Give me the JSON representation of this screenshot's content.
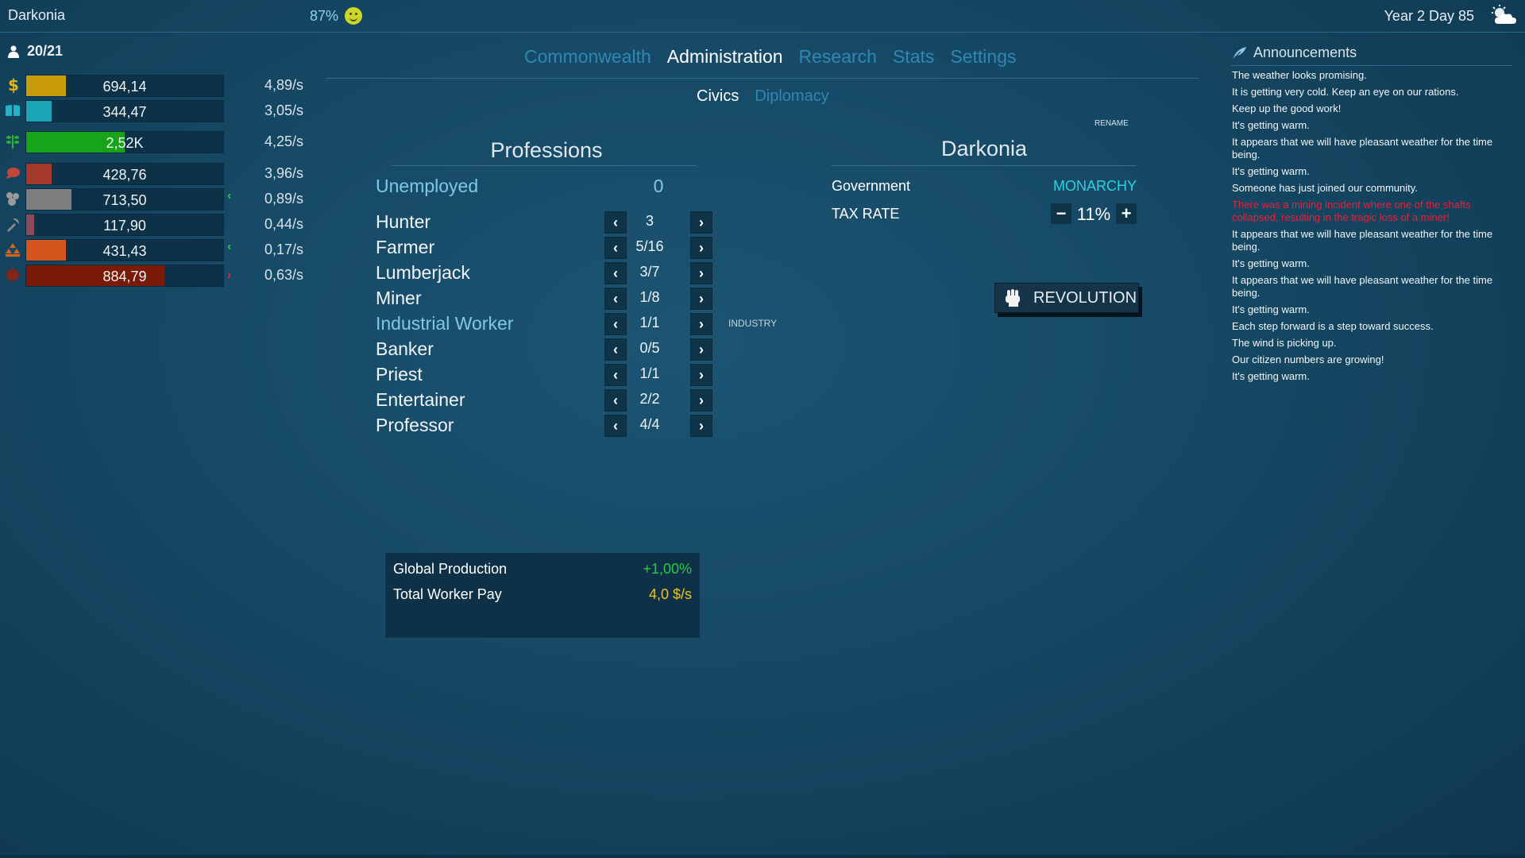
{
  "header": {
    "country_name": "Darkonia",
    "happiness": "87%",
    "happiness_icon": "smiley-face-icon",
    "date": "Year 2 Day 85",
    "weather_icon": "partly-cloudy-icon"
  },
  "population": {
    "icon": "person-icon",
    "value": "20/21"
  },
  "resources": [
    {
      "icon": "dollar-icon",
      "color": "#c99a0c",
      "fill": 0.2,
      "value": "694,14",
      "rate": "4,89/s",
      "trend": ""
    },
    {
      "icon": "book-icon",
      "color": "#1aa5b8",
      "fill": 0.13,
      "value": "344,47",
      "rate": "3,05/s",
      "trend": ""
    },
    {
      "icon": "wheat-icon",
      "color": "#18a419",
      "fill": 0.5,
      "value": "2,52K",
      "rate": "4,25/s",
      "trend": ""
    },
    {
      "icon": "meat-icon",
      "color": "#a5392a",
      "fill": 0.13,
      "value": "428,76",
      "rate": "3,96/s",
      "trend": ""
    },
    {
      "icon": "stone-icon",
      "color": "#7e7e7e",
      "fill": 0.23,
      "value": "713,50",
      "rate": "0,89/s",
      "trend": "up"
    },
    {
      "icon": "pickaxe-icon",
      "color": "#8c4a5a",
      "fill": 0.04,
      "value": "117,90",
      "rate": "0,44/s",
      "trend": ""
    },
    {
      "icon": "ore-pile-icon",
      "color": "#d2561d",
      "fill": 0.2,
      "value": "431,43",
      "rate": "0,17/s",
      "trend": "up"
    },
    {
      "icon": "gear-icon",
      "color": "#7a1b0a",
      "fill": 0.7,
      "value": "884,79",
      "rate": "0,63/s",
      "trend": "down"
    }
  ],
  "tabs": [
    "Commonwealth",
    "Administration",
    "Research",
    "Stats",
    "Settings"
  ],
  "active_tab": "Administration",
  "subtabs": [
    "Civics",
    "Diplomacy"
  ],
  "active_subtab": "Civics",
  "professions": {
    "title": "Professions",
    "unemployed_label": "Unemployed",
    "unemployed_count": "0",
    "rows": [
      {
        "name": "Hunter",
        "count": "3",
        "tag": ""
      },
      {
        "name": "Farmer",
        "count": "5/16",
        "tag": ""
      },
      {
        "name": "Lumberjack",
        "count": "3/7",
        "tag": ""
      },
      {
        "name": "Miner",
        "count": "1/8",
        "tag": ""
      },
      {
        "name": "Industrial Worker",
        "count": "1/1",
        "tag": "INDUSTRY"
      },
      {
        "name": "Banker",
        "count": "0/5",
        "tag": ""
      },
      {
        "name": "Priest",
        "count": "1/1",
        "tag": ""
      },
      {
        "name": "Entertainer",
        "count": "2/2",
        "tag": ""
      },
      {
        "name": "Professor",
        "count": "4/4",
        "tag": ""
      }
    ]
  },
  "summary": {
    "global_production_label": "Global Production",
    "global_production_value": "+1,00%",
    "worker_pay_label": "Total Worker Pay",
    "worker_pay_value": "4,0 $/s"
  },
  "nation": {
    "rename_label": "RENAME",
    "name": "Darkonia",
    "government_label": "Government",
    "government_value": "MONARCHY",
    "tax_label": "TAX RATE",
    "tax_value": "11%",
    "revolution_label": "REVOLUTION",
    "revolution_icon": "fist-icon"
  },
  "announcements": {
    "title": "Announcements",
    "icon": "feather-icon",
    "items": [
      {
        "text": "The weather looks promising.",
        "alert": false
      },
      {
        "text": "It is getting very cold. Keep an eye on our rations.",
        "alert": false
      },
      {
        "text": "Keep up the good work!",
        "alert": false
      },
      {
        "text": "It's getting warm.",
        "alert": false
      },
      {
        "text": "It appears that we will have pleasant weather for the time being.",
        "alert": false
      },
      {
        "text": "It's getting warm.",
        "alert": false
      },
      {
        "text": "Someone has just joined our community.",
        "alert": false
      },
      {
        "text": "There was a mining incident where one of the shafts collapsed, resulting in the tragic loss of a miner!",
        "alert": true
      },
      {
        "text": "It appears that we will have pleasant weather for the time being.",
        "alert": false
      },
      {
        "text": "It's getting warm.",
        "alert": false
      },
      {
        "text": "It appears that we will have pleasant weather for the time being.",
        "alert": false
      },
      {
        "text": "It's getting warm.",
        "alert": false
      },
      {
        "text": "Each step forward is a step toward success.",
        "alert": false
      },
      {
        "text": "The wind is picking up.",
        "alert": false
      },
      {
        "text": "Our citizen numbers are growing!",
        "alert": false
      },
      {
        "text": "It's getting warm.",
        "alert": false
      }
    ]
  },
  "colors": {
    "accent_cyan": "#2fd0e0",
    "positive_green": "#2fc44a",
    "gold": "#f1c21b",
    "alert_red": "#e8213a"
  }
}
